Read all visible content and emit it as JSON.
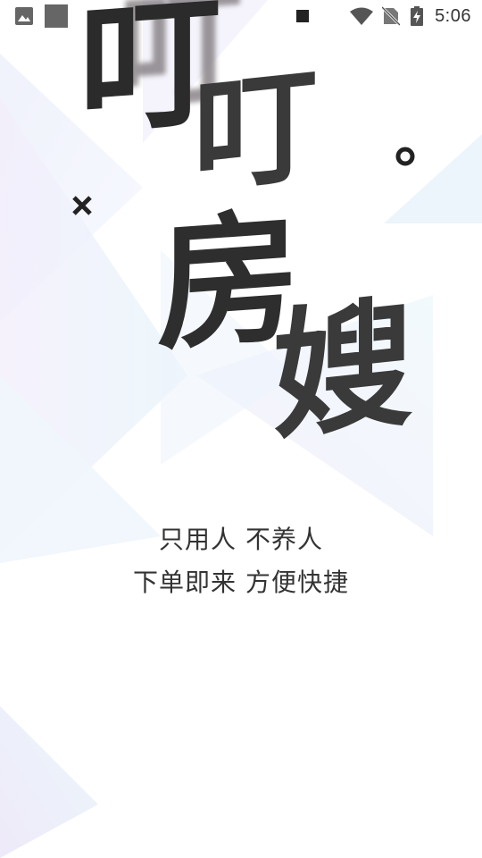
{
  "status_bar": {
    "time": "5:06",
    "left_icons": [
      "image-icon",
      "square-app-icon"
    ],
    "right_icons": [
      "stop-square-icon",
      "wifi-icon",
      "no-sim-icon",
      "battery-charging-icon"
    ]
  },
  "title": {
    "char1": "叮",
    "char2": "叮",
    "char3": "房",
    "char4": "嫂"
  },
  "slogan": {
    "line1": "只用人 不养人",
    "line2": "下单即来 方便快捷"
  },
  "colors": {
    "text_dark": "#2e2e2e",
    "text_gray": "#6a6a6a",
    "accent_pastel_blue": "#e9f4fb",
    "accent_pastel_purple": "#efeaf8"
  }
}
